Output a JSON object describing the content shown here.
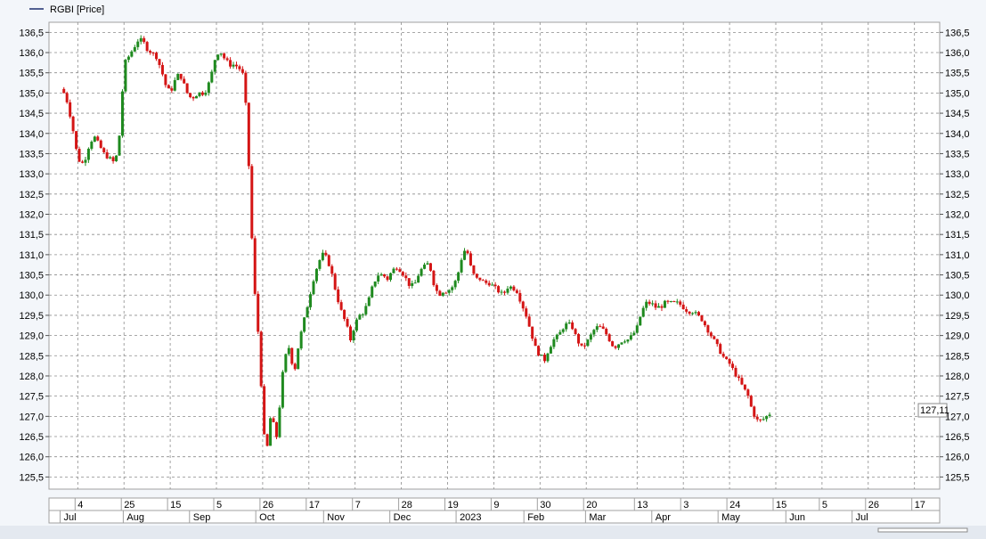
{
  "chart_data": {
    "type": "candlestick",
    "legend": "RGBI [Price]",
    "last_price_label": "127,11",
    "y_ticks": [
      "125,5",
      "126,0",
      "126,5",
      "127,0",
      "127,5",
      "128,0",
      "128,5",
      "129,0",
      "129,5",
      "130,0",
      "130,5",
      "131,0",
      "131,5",
      "132,0",
      "132,5",
      "133,0",
      "133,5",
      "134,0",
      "134,5",
      "135,0",
      "135,5",
      "136,0",
      "136,5"
    ],
    "y_range": [
      125.2,
      136.75
    ],
    "x_day_labels": [
      {
        "label": "4",
        "week": 1
      },
      {
        "label": "25",
        "week": 4
      },
      {
        "label": "15",
        "week": 7
      },
      {
        "label": "5",
        "week": 10
      },
      {
        "label": "26",
        "week": 13
      },
      {
        "label": "17",
        "week": 16
      },
      {
        "label": "7",
        "week": 19
      },
      {
        "label": "28",
        "week": 22
      },
      {
        "label": "19",
        "week": 25
      },
      {
        "label": "9",
        "week": 28
      },
      {
        "label": "30",
        "week": 31
      },
      {
        "label": "20",
        "week": 34
      },
      {
        "label": "13",
        "week": 37.3
      },
      {
        "label": "3",
        "week": 40.3
      },
      {
        "label": "24",
        "week": 43.3
      },
      {
        "label": "15",
        "week": 46.3
      },
      {
        "label": "5",
        "week": 49.3
      },
      {
        "label": "26",
        "week": 52.3
      },
      {
        "label": "17",
        "week": 55.3
      }
    ],
    "x_month_labels": [
      {
        "label": "Jul",
        "week": 0.2
      },
      {
        "label": "Aug",
        "week": 4.3
      },
      {
        "label": "Sep",
        "week": 8.6
      },
      {
        "label": "Oct",
        "week": 12.9
      },
      {
        "label": "Nov",
        "week": 17.3
      },
      {
        "label": "Dec",
        "week": 21.6
      },
      {
        "label": "2023",
        "week": 25.9
      },
      {
        "label": "Feb",
        "week": 30.3
      },
      {
        "label": "Mar",
        "week": 34.3
      },
      {
        "label": "Apr",
        "week": 38.6
      },
      {
        "label": "May",
        "week": 42.9
      },
      {
        "label": "Jun",
        "week": 47.3
      },
      {
        "label": "Jul",
        "week": 51.6
      }
    ],
    "price_path": [
      [
        0,
        135.1
      ],
      [
        0.3,
        134.8
      ],
      [
        0.6,
        134.3
      ],
      [
        0.9,
        133.6
      ],
      [
        1.2,
        133.2
      ],
      [
        1.5,
        133.4
      ],
      [
        1.8,
        133.8
      ],
      [
        2.1,
        133.9
      ],
      [
        2.4,
        133.7
      ],
      [
        2.7,
        133.5
      ],
      [
        3.0,
        133.4
      ],
      [
        3.3,
        133.3
      ],
      [
        3.6,
        133.5
      ],
      [
        3.8,
        134.4
      ],
      [
        4.0,
        135.7
      ],
      [
        4.3,
        135.9
      ],
      [
        4.6,
        136.1
      ],
      [
        4.9,
        136.3
      ],
      [
        5.2,
        136.3
      ],
      [
        5.5,
        136.1
      ],
      [
        5.8,
        136.0
      ],
      [
        6.1,
        135.9
      ],
      [
        6.4,
        135.6
      ],
      [
        6.7,
        135.2
      ],
      [
        7.0,
        135.0
      ],
      [
        7.3,
        135.3
      ],
      [
        7.6,
        135.5
      ],
      [
        7.9,
        135.2
      ],
      [
        8.2,
        134.9
      ],
      [
        8.5,
        134.9
      ],
      [
        8.8,
        135.0
      ],
      [
        9.1,
        135.0
      ],
      [
        9.4,
        135.1
      ],
      [
        9.7,
        135.5
      ],
      [
        10.0,
        136.0
      ],
      [
        10.3,
        136.0
      ],
      [
        10.6,
        135.8
      ],
      [
        10.9,
        135.7
      ],
      [
        11.2,
        135.7
      ],
      [
        11.5,
        135.6
      ],
      [
        11.8,
        135.4
      ],
      [
        12.0,
        134.0
      ],
      [
        12.2,
        132.4
      ],
      [
        12.4,
        130.4
      ],
      [
        12.6,
        129.6
      ],
      [
        12.8,
        128.6
      ],
      [
        13.0,
        127.0
      ],
      [
        13.2,
        126.0
      ],
      [
        13.4,
        126.5
      ],
      [
        13.6,
        127.4
      ],
      [
        13.8,
        126.2
      ],
      [
        14.0,
        126.8
      ],
      [
        14.2,
        127.7
      ],
      [
        14.4,
        128.4
      ],
      [
        14.6,
        128.6
      ],
      [
        14.8,
        128.8
      ],
      [
        15.0,
        127.9
      ],
      [
        15.2,
        128.5
      ],
      [
        15.4,
        128.9
      ],
      [
        15.7,
        129.4
      ],
      [
        16.0,
        129.9
      ],
      [
        16.3,
        130.4
      ],
      [
        16.6,
        130.8
      ],
      [
        16.9,
        131.0
      ],
      [
        17.2,
        130.9
      ],
      [
        17.5,
        130.5
      ],
      [
        17.8,
        130.0
      ],
      [
        18.1,
        129.6
      ],
      [
        18.4,
        129.3
      ],
      [
        18.7,
        128.9
      ],
      [
        19.0,
        129.3
      ],
      [
        19.3,
        129.5
      ],
      [
        19.6,
        129.6
      ],
      [
        19.9,
        129.9
      ],
      [
        20.2,
        130.3
      ],
      [
        20.5,
        130.5
      ],
      [
        20.8,
        130.5
      ],
      [
        21.1,
        130.4
      ],
      [
        21.4,
        130.6
      ],
      [
        21.7,
        130.7
      ],
      [
        22.0,
        130.6
      ],
      [
        22.3,
        130.4
      ],
      [
        22.6,
        130.2
      ],
      [
        22.9,
        130.3
      ],
      [
        23.2,
        130.6
      ],
      [
        23.5,
        130.7
      ],
      [
        23.8,
        130.8
      ],
      [
        24.1,
        130.3
      ],
      [
        24.4,
        130.0
      ],
      [
        24.7,
        130.1
      ],
      [
        25.0,
        130.1
      ],
      [
        25.3,
        130.2
      ],
      [
        25.6,
        130.4
      ],
      [
        25.9,
        130.9
      ],
      [
        26.2,
        131.2
      ],
      [
        26.5,
        130.7
      ],
      [
        26.8,
        130.4
      ],
      [
        27.1,
        130.4
      ],
      [
        27.4,
        130.3
      ],
      [
        27.7,
        130.3
      ],
      [
        28.0,
        130.2
      ],
      [
        28.3,
        130.1
      ],
      [
        28.6,
        130.0
      ],
      [
        28.9,
        130.2
      ],
      [
        29.2,
        130.2
      ],
      [
        29.5,
        130.1
      ],
      [
        29.8,
        129.8
      ],
      [
        30.1,
        129.5
      ],
      [
        30.4,
        129.1
      ],
      [
        30.7,
        128.7
      ],
      [
        31.0,
        128.5
      ],
      [
        31.3,
        128.4
      ],
      [
        31.6,
        128.7
      ],
      [
        31.9,
        128.9
      ],
      [
        32.2,
        129.0
      ],
      [
        32.5,
        129.2
      ],
      [
        32.8,
        129.3
      ],
      [
        33.1,
        129.2
      ],
      [
        33.4,
        128.9
      ],
      [
        33.7,
        128.7
      ],
      [
        34.0,
        128.8
      ],
      [
        34.3,
        129.0
      ],
      [
        34.6,
        129.2
      ],
      [
        34.9,
        129.2
      ],
      [
        35.2,
        129.1
      ],
      [
        35.5,
        128.9
      ],
      [
        35.8,
        128.7
      ],
      [
        36.1,
        128.8
      ],
      [
        36.4,
        128.9
      ],
      [
        36.7,
        128.9
      ],
      [
        37.0,
        129.0
      ],
      [
        37.3,
        129.2
      ],
      [
        37.6,
        129.6
      ],
      [
        37.9,
        129.8
      ],
      [
        38.2,
        129.8
      ],
      [
        38.5,
        129.7
      ],
      [
        38.8,
        129.7
      ],
      [
        39.1,
        129.8
      ],
      [
        39.4,
        129.8
      ],
      [
        39.7,
        129.8
      ],
      [
        40.0,
        129.8
      ],
      [
        40.3,
        129.7
      ],
      [
        40.6,
        129.6
      ],
      [
        40.9,
        129.6
      ],
      [
        41.2,
        129.5
      ],
      [
        41.5,
        129.4
      ],
      [
        41.8,
        129.2
      ],
      [
        42.1,
        129.0
      ],
      [
        42.4,
        128.8
      ],
      [
        42.7,
        128.6
      ],
      [
        43.0,
        128.4
      ],
      [
        43.3,
        128.3
      ],
      [
        43.6,
        128.1
      ],
      [
        43.9,
        127.9
      ],
      [
        44.2,
        127.7
      ],
      [
        44.5,
        127.5
      ],
      [
        44.8,
        127.1
      ],
      [
        45.1,
        126.9
      ],
      [
        45.4,
        126.9
      ],
      [
        45.7,
        127.0
      ],
      [
        46.0,
        127.1
      ]
    ]
  }
}
